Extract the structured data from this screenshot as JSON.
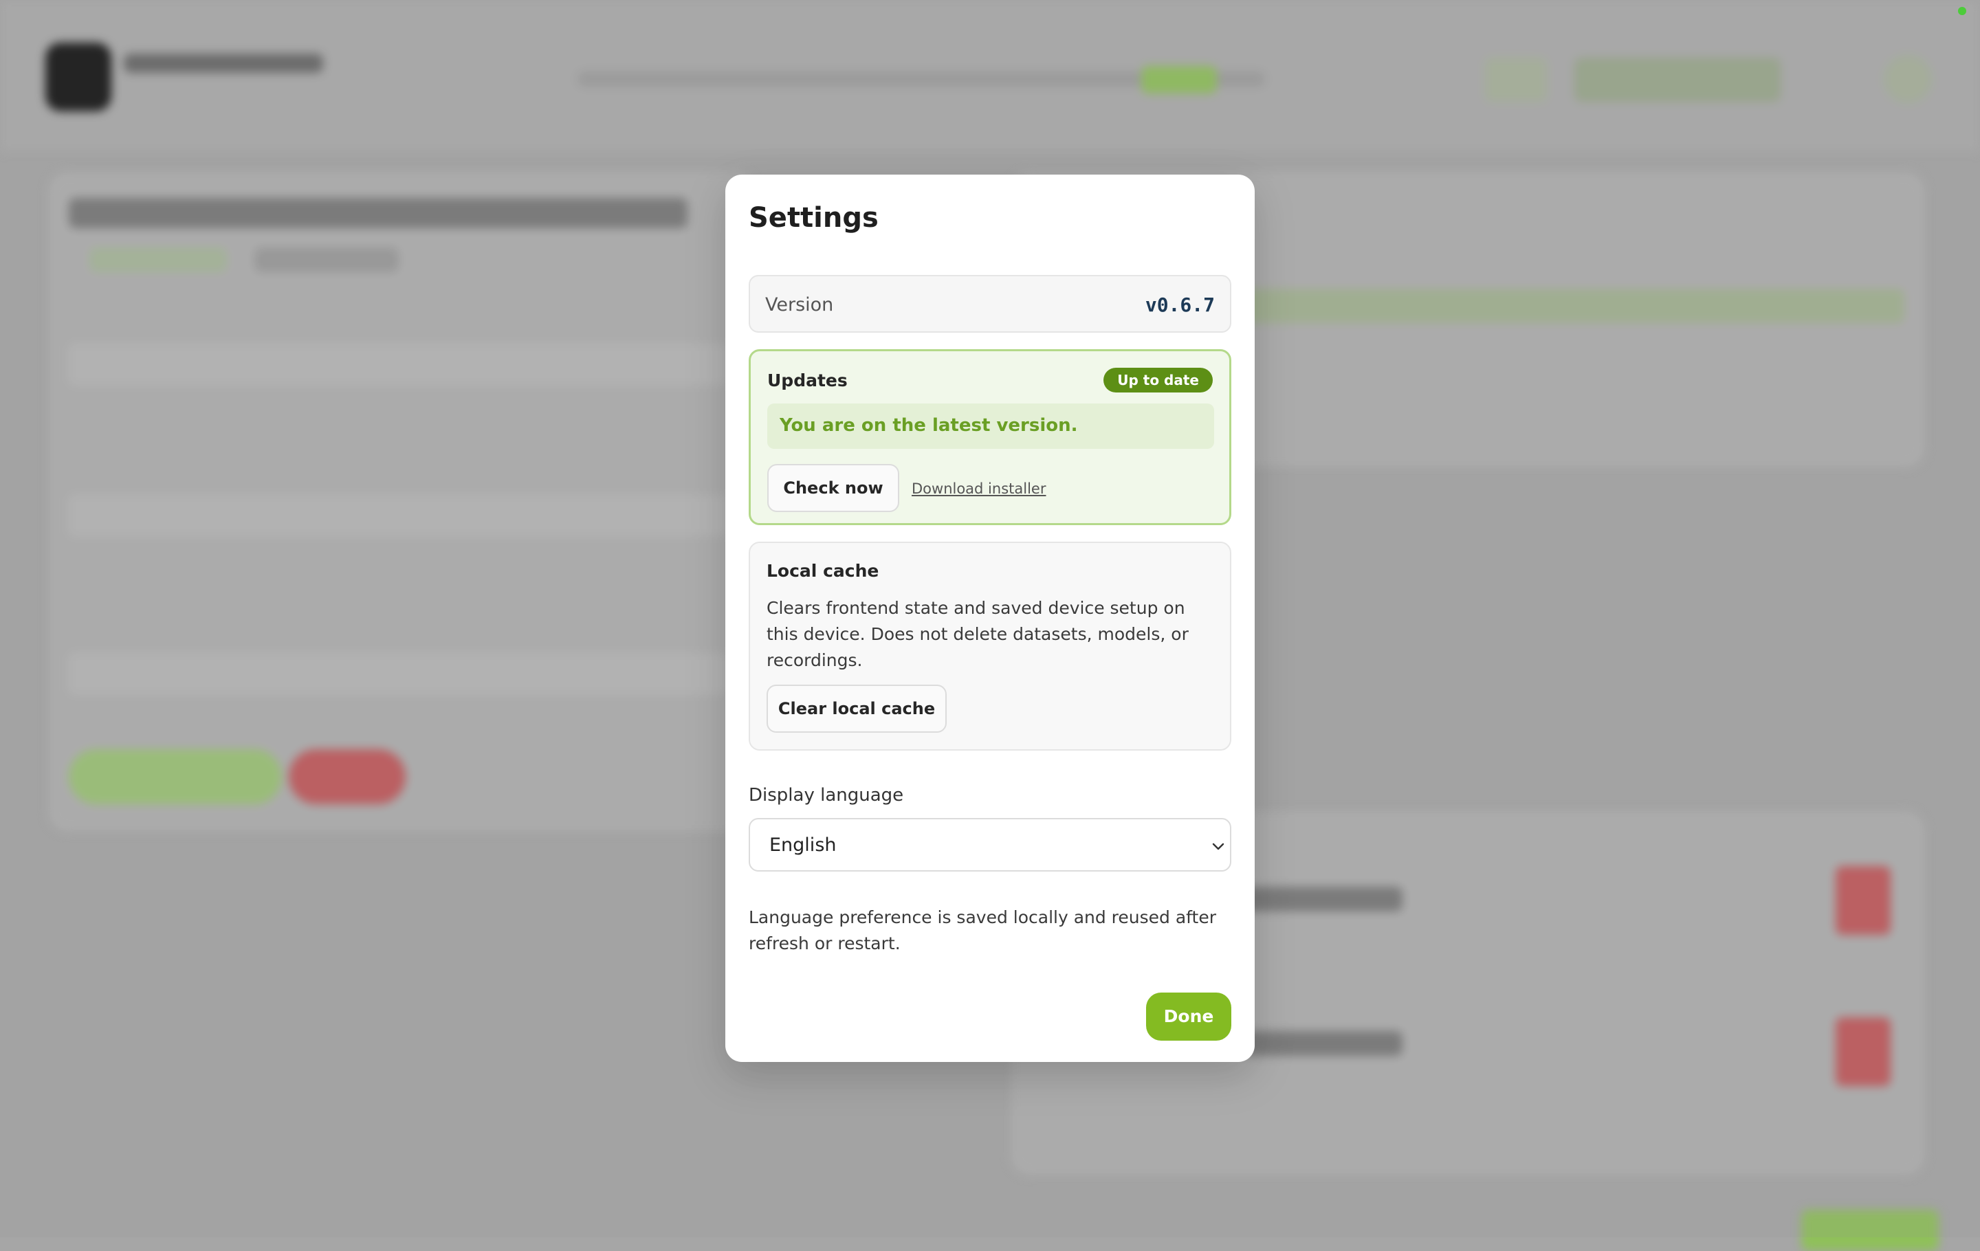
{
  "modal": {
    "title": "Settings",
    "version": {
      "label": "Version",
      "value": "v0.6.7"
    },
    "updates": {
      "title": "Updates",
      "badge": "Up to date",
      "status_message": "You are on the latest version.",
      "check_button": "Check now",
      "download_link": "Download installer"
    },
    "local_cache": {
      "title": "Local cache",
      "description": "Clears frontend state and saved device setup on this device. Does not delete datasets, models, or recordings.",
      "clear_button": "Clear local cache"
    },
    "display_language": {
      "label": "Display language",
      "selected": "English",
      "note": "Language preference is saved locally and reused after refresh or restart."
    },
    "done_button": "Done"
  },
  "colors": {
    "accent": "#84bb22",
    "badge": "#5d8f15",
    "status_text": "#6a9f24",
    "version_text": "#1d3a57"
  },
  "icons": {
    "language_select": "chevron-down-icon"
  }
}
